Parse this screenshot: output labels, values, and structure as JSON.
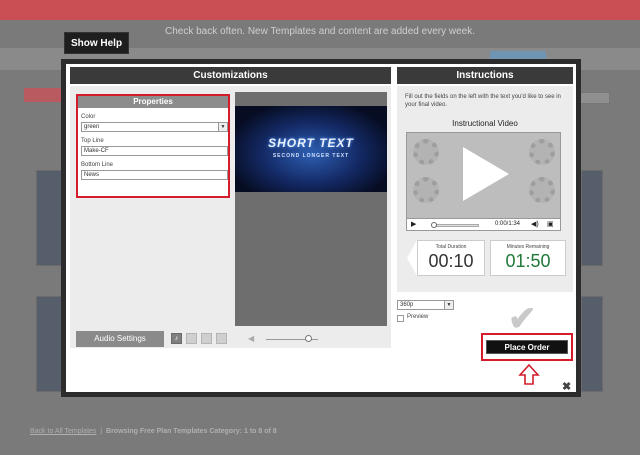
{
  "background": {
    "banner_text": "",
    "notice": "Check back often. New Templates and content are added every week.",
    "bottom_link": "Back to All Templates",
    "bottom_text": "Browsing Free Plan Templates Category: 1 to 8 of 8"
  },
  "show_help": {
    "label": "Show Help"
  },
  "customizations": {
    "header": "Customizations",
    "properties": {
      "header": "Properties",
      "color": {
        "label": "Color",
        "value": "green"
      },
      "top_line": {
        "label": "Top Line",
        "value": "Make-CF"
      },
      "bottom_line": {
        "label": "Bottom Line",
        "value": "News"
      }
    },
    "preview": {
      "title": "SHORT TEXT",
      "subtitle": "SECOND LONGER TEXT"
    },
    "audio": {
      "label": "Audio Settings"
    }
  },
  "instructions": {
    "header": "Instructions",
    "text": "Fill out the fields on the left with the text you'd like to see in your final video.",
    "video_label": "Instructional Video",
    "player": {
      "time": "0:00/1:34"
    },
    "total_duration": {
      "label": "Total Duration",
      "value": "00:10"
    },
    "minutes_remaining": {
      "label": "Minutes Remaining",
      "value": "01:50"
    }
  },
  "quality": {
    "value": "360p"
  },
  "preview": {
    "label": "Preview"
  },
  "order": {
    "label": "Place Order"
  },
  "colors": {
    "highlight": "#d41c2c",
    "remaining": "#1f7a3a",
    "header_bg": "#3a3a3a"
  }
}
